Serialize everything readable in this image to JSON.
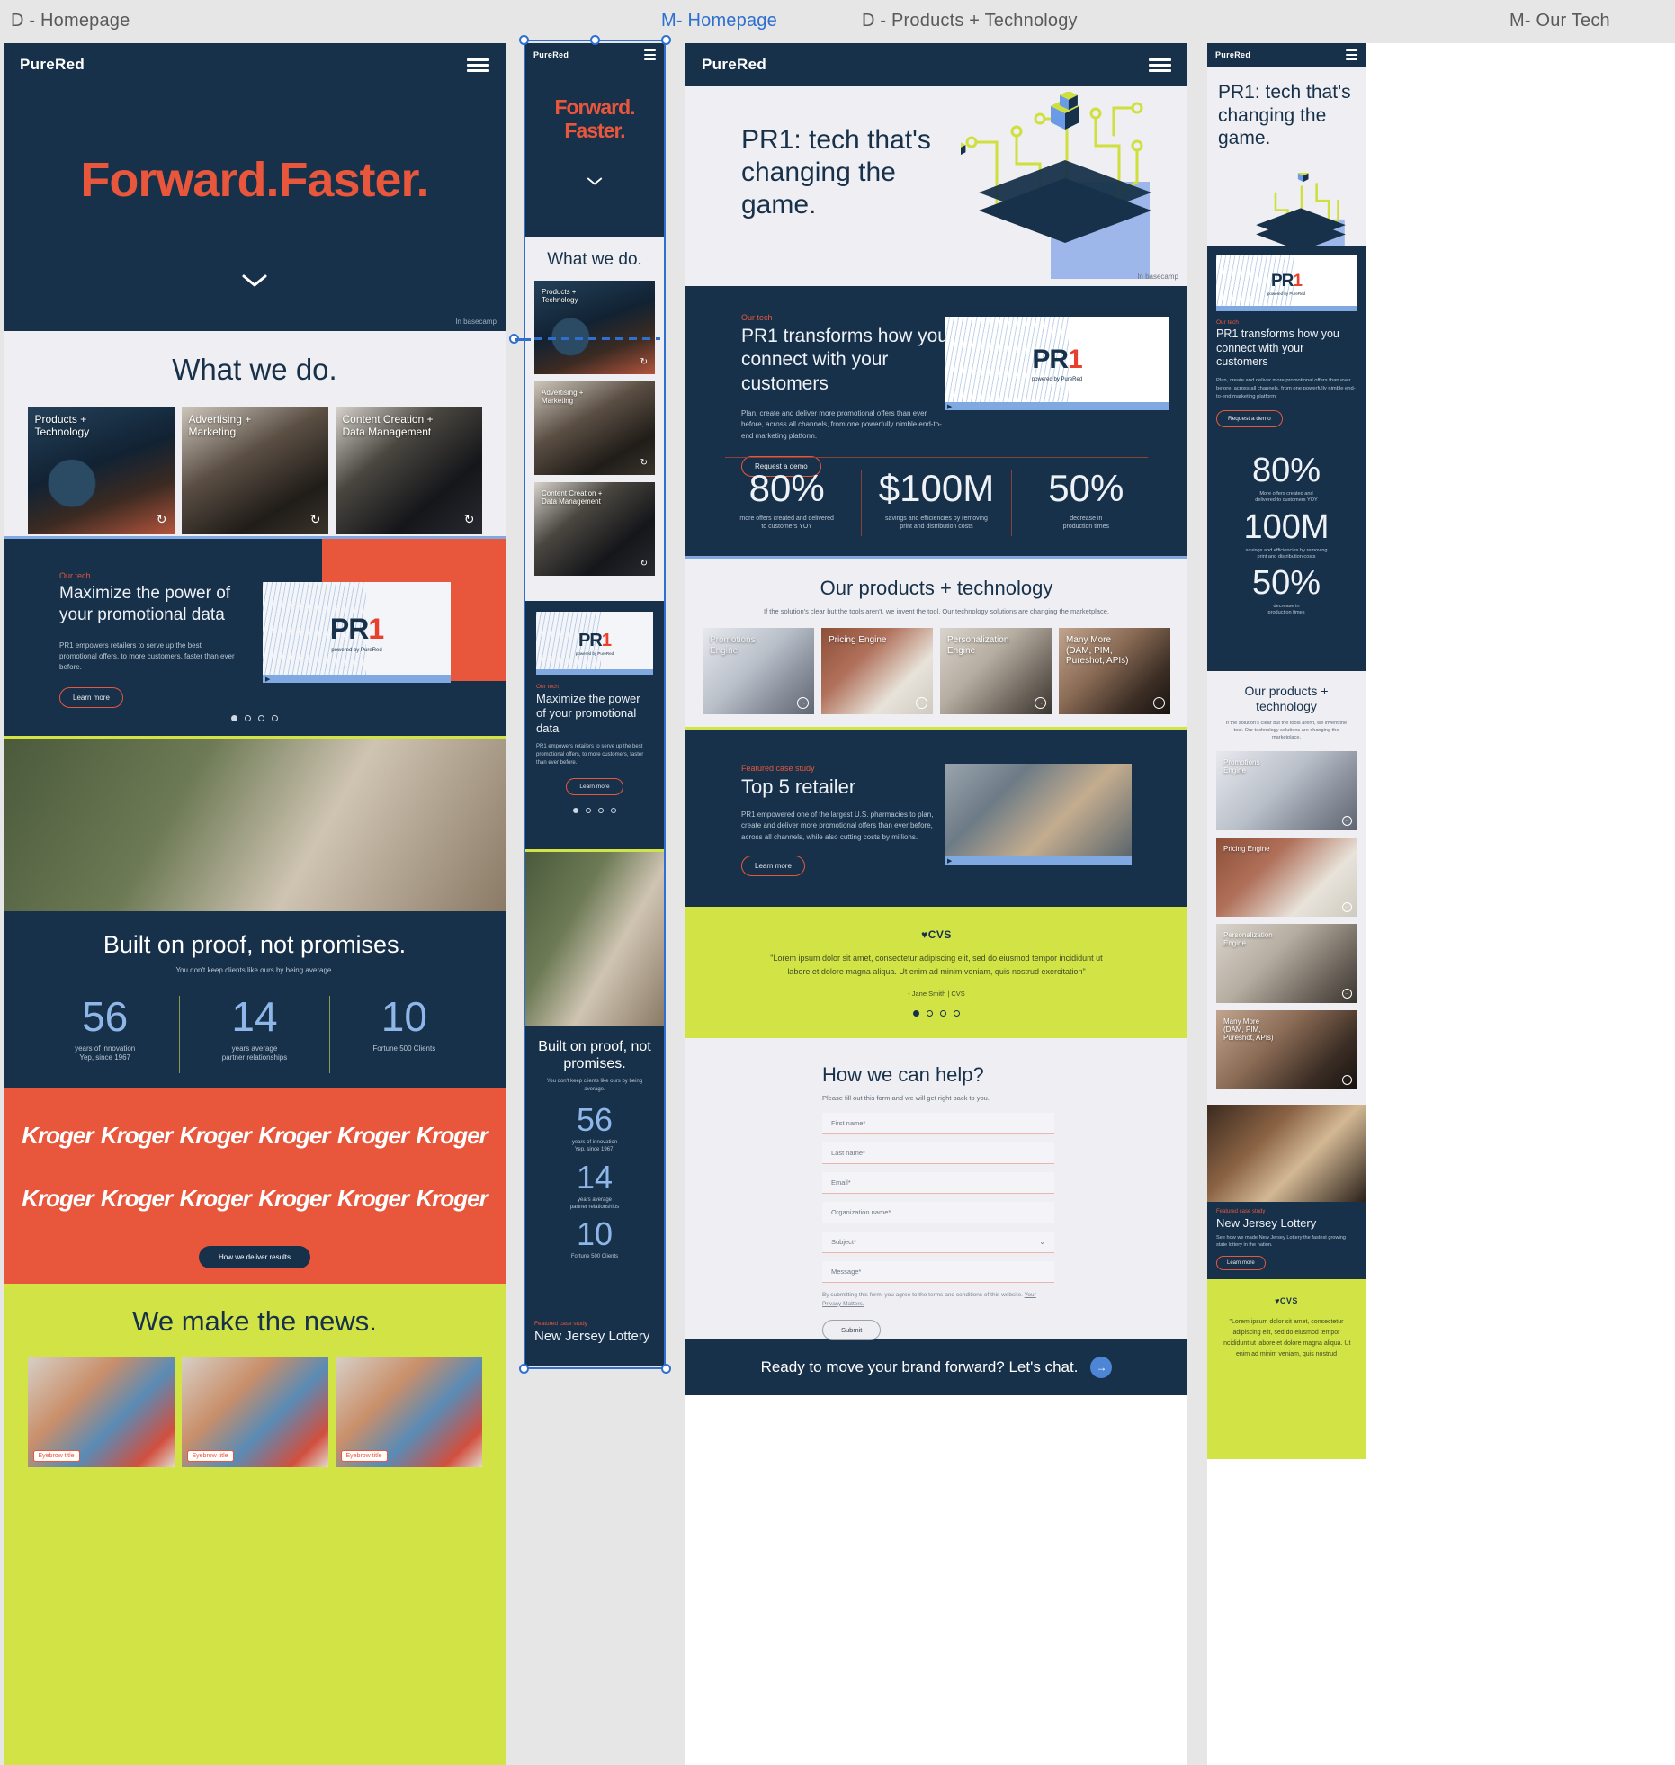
{
  "canvas": {
    "labels": [
      {
        "text": "D - Homepage",
        "selected": false
      },
      {
        "text": "M- Homepage",
        "selected": true
      },
      {
        "text": "D - Products + Technology",
        "selected": false
      },
      {
        "text": "M- Our Tech",
        "selected": false
      }
    ]
  },
  "brand": {
    "name": "PureRed",
    "watermark": "In basecamp"
  },
  "colors": {
    "navy": "#17314a",
    "red": "#e8563c",
    "lime": "#d2e445",
    "blue": "#8fb6e8",
    "light": "#eeeef3"
  },
  "homepage": {
    "hero": {
      "title": "Forward.Faster.",
      "chevron": "chevron-down"
    },
    "what_we_do": {
      "heading": "What we do.",
      "cards": [
        {
          "title": "Products +\nTechnology",
          "image": "developer-at-monitors"
        },
        {
          "title": "Advertising +\nMarketing",
          "image": "two-men-with-laptop"
        },
        {
          "title": "Content Creation +\nData Management",
          "image": "video-camera"
        }
      ]
    },
    "tech": {
      "eyebrow": "Our tech",
      "heading": "Maximize the power of your promotional data",
      "body": "PR1 empowers retailers to serve up the best promotional offers, to more customers, faster than ever before.",
      "cta": "Learn more",
      "logo": {
        "mark": "PR",
        "accent": "1",
        "byline": "powered by PureRed"
      },
      "dots": 4,
      "active_dot": 0
    },
    "proof": {
      "heading": "Built on proof, not promises.",
      "sub": "You don't keep clients like ours by being average.",
      "stats": [
        {
          "value": "56",
          "label": "years of innovation\nYep, since 1967"
        },
        {
          "value": "14",
          "label": "years average\npartner relationships"
        },
        {
          "value": "10",
          "label": "Fortune 500 Clients"
        }
      ]
    },
    "clients": {
      "logo": "Kroger",
      "count": 12,
      "cta": "How we deliver results"
    },
    "news": {
      "heading": "We make the news.",
      "cards": [
        {
          "eyebrow": "Eyebrow title"
        },
        {
          "eyebrow": "Eyebrow title"
        },
        {
          "eyebrow": "Eyebrow title"
        }
      ]
    }
  },
  "products_page": {
    "hero": {
      "heading": "PR1: tech that's changing the game.",
      "illustration": "isometric-network-cube"
    },
    "tech": {
      "eyebrow": "Our tech",
      "heading": "PR1 transforms how you connect with your customers",
      "body": "Plan, create and deliver more promotional offers than ever before, across all channels, from one powerfully nimble end-to-end marketing platform.",
      "cta": "Request a demo",
      "logo": {
        "mark": "PR",
        "accent": "1",
        "byline": "powered by PureRed"
      }
    },
    "stats": [
      {
        "value": "80%",
        "label": "more offers created and delivered\nto customers YOY"
      },
      {
        "value": "$100M",
        "label": "savings and efficiencies by removing\nprint and distribution costs"
      },
      {
        "value": "50%",
        "label": "decrease in\nproduction times"
      }
    ],
    "products": {
      "heading": "Our products + technology",
      "sub": "If the solution's clear but the tools aren't, we invent the tool. Our technology solutions are changing the marketplace.",
      "cards": [
        {
          "title": "Promotions\nEngine",
          "image": "hand-holding-phone"
        },
        {
          "title": "Pricing Engine",
          "image": "man-at-laptop-brick-wall"
        },
        {
          "title": "Personalization\nEngine",
          "image": "hand-sketching-wireframes"
        },
        {
          "title": "Many More\n(DAM, PIM,\nPureshot, APIs)",
          "image": "hand-with-device"
        }
      ]
    },
    "case_study": {
      "eyebrow": "Featured case study",
      "heading": "Top 5 retailer",
      "body": "PR1 empowered one of the largest U.S. pharmacies to plan, create and deliver more promotional offers than ever before, across all channels, while also cutting costs by millions.",
      "cta": "Learn more",
      "image": "shopping-cart-in-store"
    },
    "testimonial": {
      "logo": "CVS",
      "quote": "\"Lorem ipsum dolor sit amet, consectetur adipiscing elit, sed do eiusmod tempor incididunt ut labore et dolore magna aliqua. Ut enim ad minim veniam, quis nostrud exercitation\"",
      "attribution": "- Jane Smith | CVS",
      "dots": 4,
      "active_dot": 0
    },
    "form": {
      "heading": "How we can help?",
      "sub": "Please fill out this form and we will get right back to you.",
      "fields": [
        {
          "placeholder": "First name*",
          "type": "text"
        },
        {
          "placeholder": "Last name*",
          "type": "text"
        },
        {
          "placeholder": "Email*",
          "type": "email"
        },
        {
          "placeholder": "Organization name*",
          "type": "text"
        },
        {
          "placeholder": "Subject*",
          "type": "select"
        },
        {
          "placeholder": "Message*",
          "type": "textarea"
        }
      ],
      "legal": "By submitting this form, you agree to the terms and conditions of this website.",
      "legal_link": "Your Privacy Matters.",
      "submit": "Submit"
    },
    "cta_bar": {
      "text": "Ready to move your brand forward? Let's chat.",
      "icon": "arrow-right"
    }
  },
  "mobile_homepage": {
    "hero": {
      "title": "Forward.\nFaster."
    },
    "what_we_do": {
      "heading": "What we do.",
      "cards": [
        {
          "title": "Products +\nTechnology"
        },
        {
          "title": "Advertising +\nMarketing"
        },
        {
          "title": "Content Creation +\nData Management"
        }
      ]
    },
    "tech": {
      "eyebrow": "Our tech",
      "heading": "Maximize the power of your promotional data",
      "body": "PR1 empowers retailers to serve up the best promotional offers, to more customers, faster than ever before.",
      "cta": "Learn more"
    },
    "proof": {
      "heading": "Built on proof, not promises.",
      "sub": "You don't keep clients like ours by being average.",
      "stats": [
        {
          "value": "56",
          "label": "years of innovation\nYep, since 1967."
        },
        {
          "value": "14",
          "label": "years average\npartner relationships"
        },
        {
          "value": "10",
          "label": "Fortune 500 Clients"
        }
      ]
    },
    "case_study": {
      "eyebrow": "Featured case study",
      "heading": "New Jersey Lottery"
    }
  },
  "mobile_tech": {
    "hero": {
      "heading": "PR1: tech that's changing the game."
    },
    "tech": {
      "eyebrow": "Our tech",
      "heading": "PR1 transforms how you connect with your customers",
      "body": "Plan, create and deliver more promotional offers than ever before, across all channels, from one powerfully nimble end-to-end marketing platform.",
      "cta": "Request a demo"
    },
    "stats": [
      {
        "value": "80%",
        "label": "More offers created and\ndelivered to customers YOY"
      },
      {
        "value": "100M",
        "label": "savings and efficiencies by removing\nprint and distribution costs"
      },
      {
        "value": "50%",
        "label": "decrease in\nproduction times"
      }
    ],
    "products": {
      "heading": "Our products + technology",
      "sub": "If the solution's clear but the tools aren't, we invent the tool. Our technology solutions are changing the marketplace.",
      "cards": [
        {
          "title": "Promotions\nEngine"
        },
        {
          "title": "Pricing Engine"
        },
        {
          "title": "Personalization\nEngine"
        },
        {
          "title": "Many More\n(DAM, PIM,\nPureshot, APIs)"
        }
      ]
    },
    "case_study": {
      "eyebrow": "Featured case study",
      "heading": "New Jersey Lottery",
      "body": "See how we made New Jersey Lottery the fastest growing state lottery in the nation.",
      "cta": "Learn more"
    },
    "testimonial": {
      "logo": "CVS",
      "quote": "\"Lorem ipsum dolor sit amet, consectetur adipiscing elit, sed do eiusmod tempor incididunt ut labore et dolore magna aliqua. Ut enim ad minim veniam, quis nostrud"
    }
  }
}
